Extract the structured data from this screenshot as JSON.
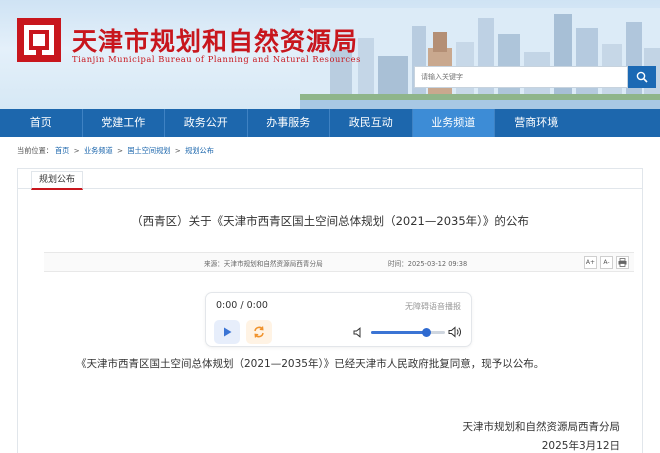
{
  "header": {
    "title_cn": "天津市规划和自然资源局",
    "title_en": "Tianjin Municipal Bureau of Planning and Natural Resources",
    "search_placeholder": "请输入关键字",
    "logo_color": "#c8161d",
    "banner_color": "#d6e8f5"
  },
  "nav": {
    "items": [
      "首页",
      "党建工作",
      "政务公开",
      "办事服务",
      "政民互动",
      "业务频道",
      "营商环境"
    ],
    "active_index": 5,
    "bg_color": "#1d67ad",
    "active_color": "#3d8cd6"
  },
  "breadcrumb": {
    "prefix": "当前位置：",
    "items": [
      "首页",
      "业务频道",
      "国土空间规划",
      "规划公布"
    ],
    "separator": ">"
  },
  "panel": {
    "tab_label": "规划公布"
  },
  "article": {
    "title": "（西青区）关于《天津市西青区国土空间总体规划（2021—2035年）》的公布",
    "source": "来源：天津市规划和自然资源局西青分局",
    "time": "时间：2025-03-12 09:38",
    "font_increase": "A+",
    "font_decrease": "A-",
    "body": "《天津市西青区国土空间总体规划（2021—2035年）》已经天津市人民政府批复同意，现予以公布。",
    "signature_org": "天津市规划和自然资源局西青分局",
    "signature_date": "2025年3月12日"
  },
  "player": {
    "time": "0:00 / 0:00",
    "label": "无障碍语音播报",
    "volume": 0.75
  }
}
